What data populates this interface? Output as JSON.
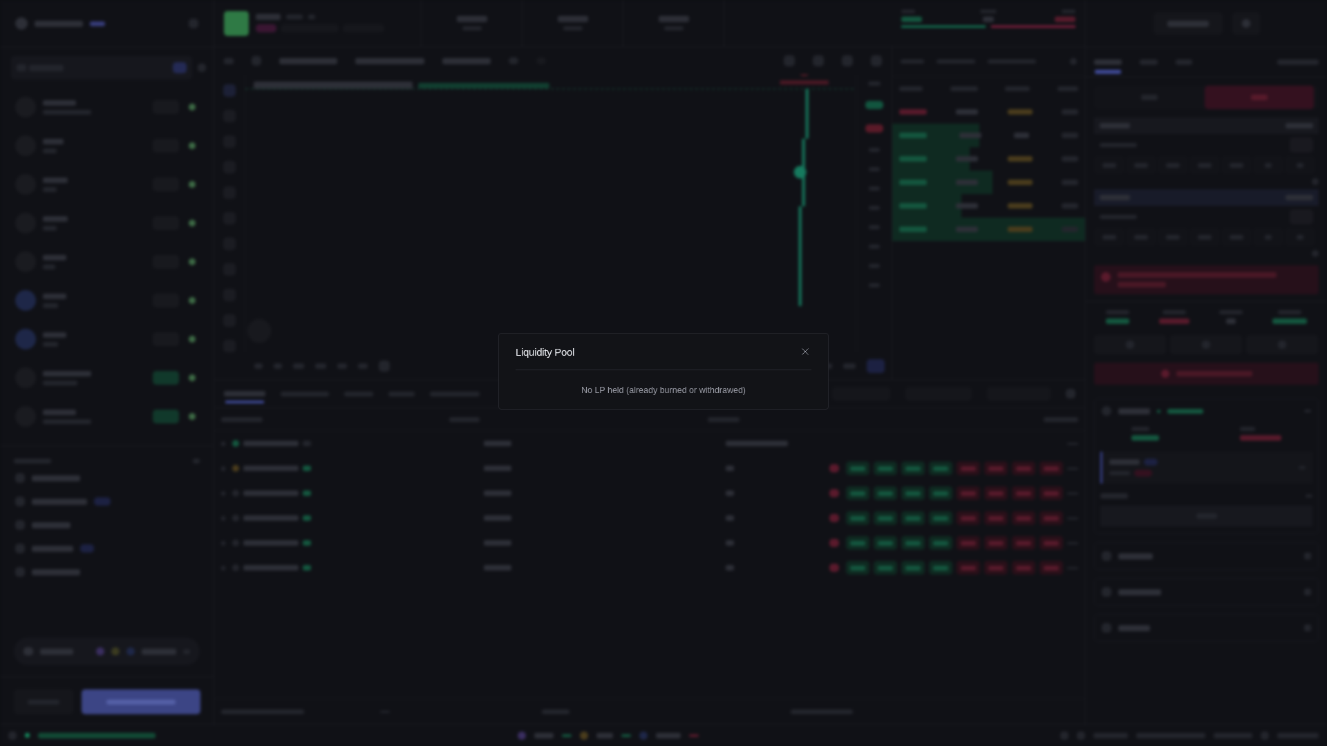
{
  "modal": {
    "title": "Liquidity Pool",
    "message": "No LP held (already burned or withdrawed)"
  }
}
